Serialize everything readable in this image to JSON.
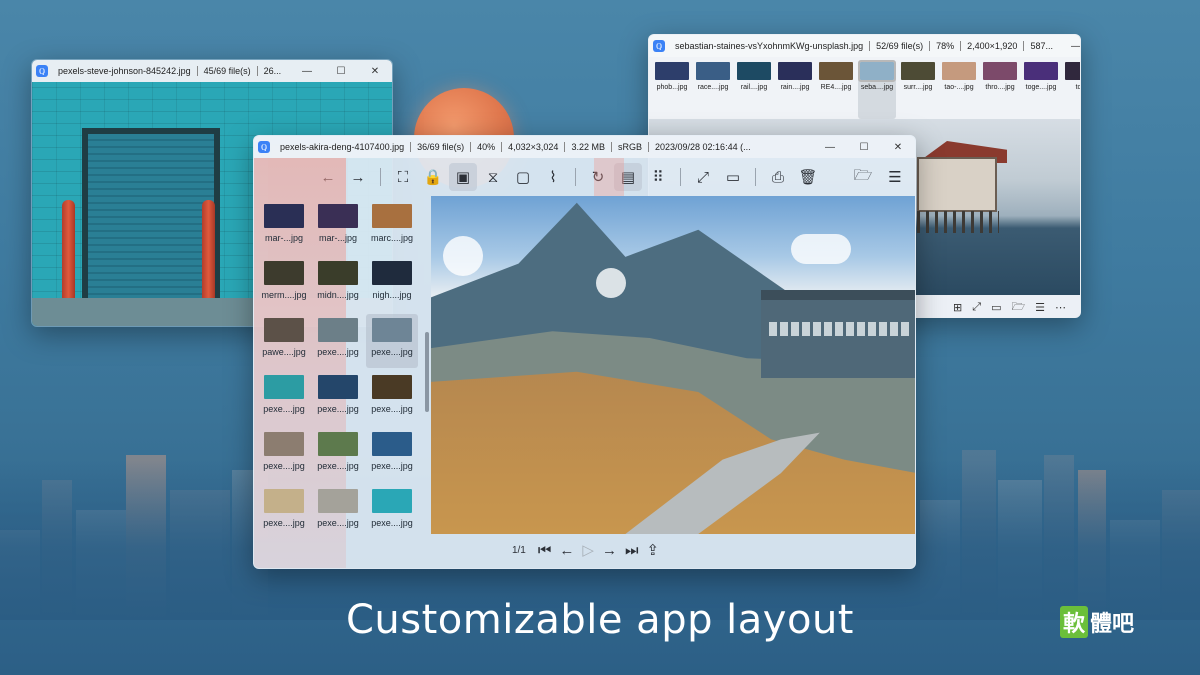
{
  "windows": {
    "left": {
      "title": "pexels-steve-johnson-845242.jpg",
      "count": "45/69 file(s)",
      "extra": "26..."
    },
    "right": {
      "title": "sebastian-staines-vsYxohnmKWg-unsplash.jpg",
      "count": "52/69 file(s)",
      "zoom": "78%",
      "dimensions": "2,400×1,920",
      "extra": "587...",
      "thumbs": [
        "phob...jpg",
        "race....jpg",
        "rail....jpg",
        "rain....jpg",
        "RE4....jpg",
        "seba....jpg",
        "surr....jpg",
        "tao-....jpg",
        "thro....jpg",
        "toge....jpg",
        "toky"
      ]
    },
    "main": {
      "title": "pexels-akira-deng-4107400.jpg",
      "count": "36/69 file(s)",
      "zoom": "40%",
      "dimensions": "4,032×3,024",
      "size": "3.22 MB",
      "colorspace": "sRGB",
      "date": "2023/09/28 02:16:44 (...",
      "gallery": [
        "mar-...jpg",
        "mar-...jpg",
        "marc....jpg",
        "merm....jpg",
        "midn....jpg",
        "nigh....jpg",
        "pawe....jpg",
        "pexe....jpg",
        "pexe....jpg",
        "pexe....jpg",
        "pexe....jpg",
        "pexe....jpg",
        "pexe....jpg",
        "pexe....jpg",
        "pexe....jpg",
        "pexe....jpg",
        "pexe....jpg",
        "pexe....jpg"
      ],
      "page_indicator": "1/1"
    }
  },
  "window_controls": {
    "minimize": "—",
    "maximize": "☐",
    "close": "✕"
  },
  "caption": "Customizable app layout",
  "logo": {
    "box": "軟",
    "rest": "體吧"
  },
  "colors": {
    "accent": "#3b82f6",
    "logo_green": "#6bbf3a"
  }
}
